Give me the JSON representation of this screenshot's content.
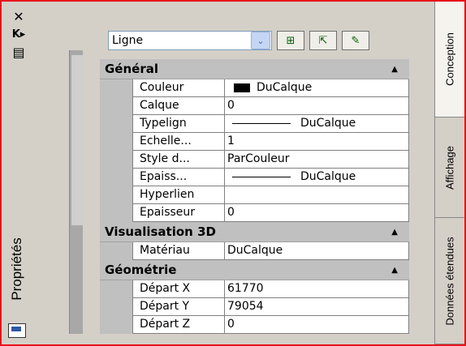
{
  "window": {
    "close_glyph": "✕",
    "autohide_glyph": "K▸",
    "menu_glyph": "▤",
    "title": "Propriétés"
  },
  "toolbar": {
    "selection_value": "Ligne",
    "dropdown_glyph": "⌄",
    "btn1_glyph": "⊞",
    "btn2_glyph": "⇱",
    "btn3_glyph": "✎"
  },
  "categories": [
    {
      "label": "Général",
      "toggle": "▲",
      "rows": [
        {
          "name": "Couleur",
          "value": "DuCalque",
          "kind": "color"
        },
        {
          "name": "Calque",
          "value": "0",
          "kind": "text"
        },
        {
          "name": "Typelign",
          "value": "DuCalque",
          "kind": "line"
        },
        {
          "name": "Echelle...",
          "value": "1",
          "kind": "text"
        },
        {
          "name": "Style d...",
          "value": "ParCouleur",
          "kind": "text"
        },
        {
          "name": "Epaiss...",
          "value": "DuCalque",
          "kind": "line"
        },
        {
          "name": "Hyperlien",
          "value": "",
          "kind": "text"
        },
        {
          "name": "Epaisseur",
          "value": "0",
          "kind": "text"
        }
      ]
    },
    {
      "label": "Visualisation 3D",
      "toggle": "▲",
      "rows": [
        {
          "name": "Matériau",
          "value": "DuCalque",
          "kind": "text"
        }
      ]
    },
    {
      "label": "Géométrie",
      "toggle": "▲",
      "rows": [
        {
          "name": "Départ X",
          "value": "61770",
          "kind": "text"
        },
        {
          "name": "Départ Y",
          "value": "79054",
          "kind": "text"
        },
        {
          "name": "Départ Z",
          "value": "0",
          "kind": "text"
        }
      ]
    }
  ],
  "tabs": [
    {
      "label": "Conception",
      "active": true
    },
    {
      "label": "Affichage",
      "active": false
    },
    {
      "label": "Données étendues",
      "active": false
    }
  ],
  "colors": {
    "frame_border": "#e8141b",
    "panel_bg": "#d4d0c8",
    "category_bg": "#c0c0c0"
  }
}
